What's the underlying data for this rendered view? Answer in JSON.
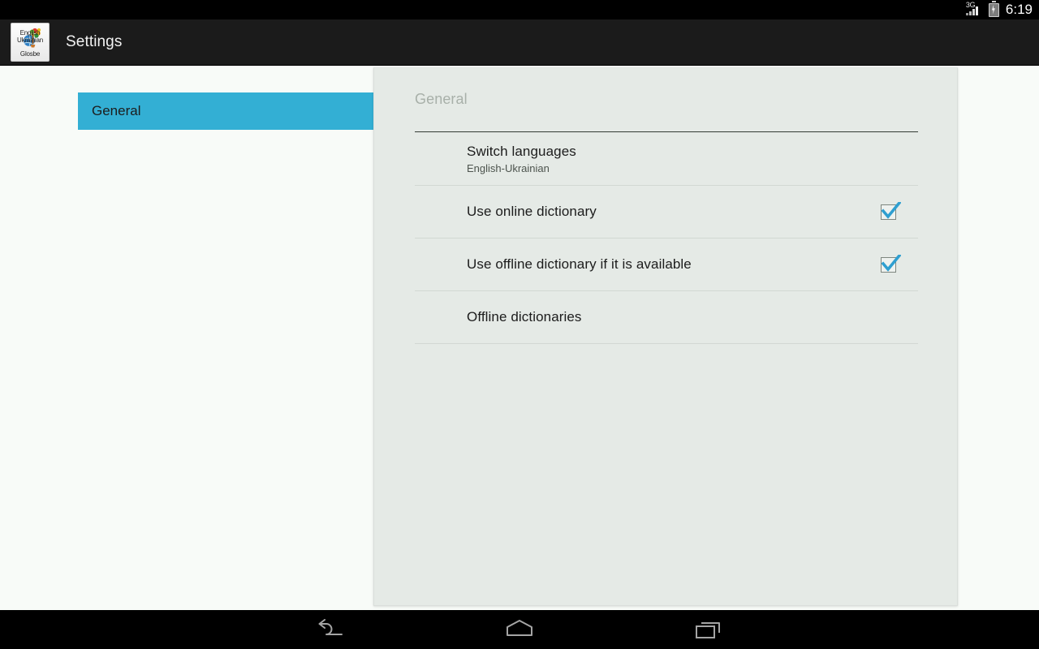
{
  "status_bar": {
    "network_label": "3G",
    "signal_icon": "signal-bars-icon",
    "battery_icon": "battery-charging-icon",
    "time": "6:19"
  },
  "action_bar": {
    "app_icon": {
      "name": "app-icon-glosbe",
      "line1": "English",
      "line2": "Ukrainian",
      "line3": "Glosbe"
    },
    "title": "Settings"
  },
  "sidebar": {
    "items": [
      {
        "label": "General",
        "selected": true
      }
    ],
    "selected_color": "#33afd4"
  },
  "panel": {
    "header": "General",
    "preferences": [
      {
        "title": "Switch languages",
        "summary": "English-Ukrainian",
        "has_checkbox": false,
        "checked": false
      },
      {
        "title": "Use online dictionary",
        "summary": "",
        "has_checkbox": true,
        "checked": true
      },
      {
        "title": "Use offline dictionary if it is available",
        "summary": "",
        "has_checkbox": true,
        "checked": true
      },
      {
        "title": "Offline dictionaries",
        "summary": "",
        "has_checkbox": false,
        "checked": false
      }
    ],
    "background_color": "#e5eae6",
    "checkbox_color": "#2f9fd0"
  },
  "nav_bar": {
    "back": "back-icon",
    "home": "home-icon",
    "recents": "recent-apps-icon"
  },
  "colors": {
    "accent": "#33afd4",
    "panel_bg": "#e5eae6",
    "page_bg": "#f8fbf8",
    "bar_bg": "#1b1b1b"
  }
}
